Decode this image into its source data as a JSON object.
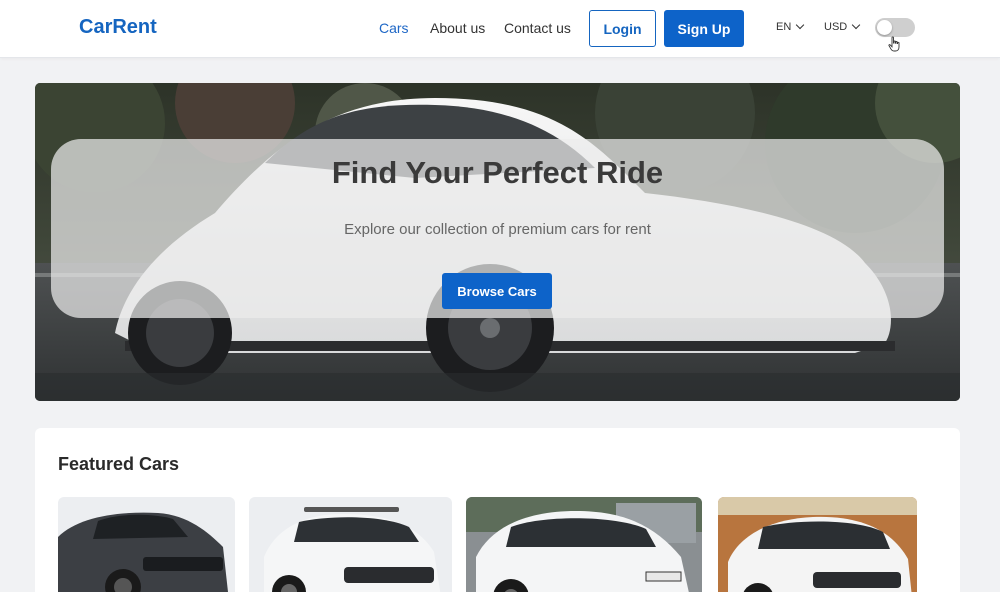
{
  "app": {
    "logo": "CarRent"
  },
  "nav": {
    "links": [
      {
        "label": "Cars",
        "active": true
      },
      {
        "label": "About us",
        "active": false
      },
      {
        "label": "Contact us",
        "active": false
      }
    ],
    "login_label": "Login",
    "signup_label": "Sign Up",
    "language": "EN",
    "currency": "USD",
    "theme_toggle_on": false
  },
  "hero": {
    "title": "Find Your Perfect Ride",
    "subtitle": "Explore our collection of premium cars for rent",
    "cta_label": "Browse Cars"
  },
  "featured": {
    "title": "Featured Cars"
  },
  "colors": {
    "brand": "#1565c0",
    "primary_button": "#0d63c9",
    "page_bg": "#f1f2f4"
  }
}
